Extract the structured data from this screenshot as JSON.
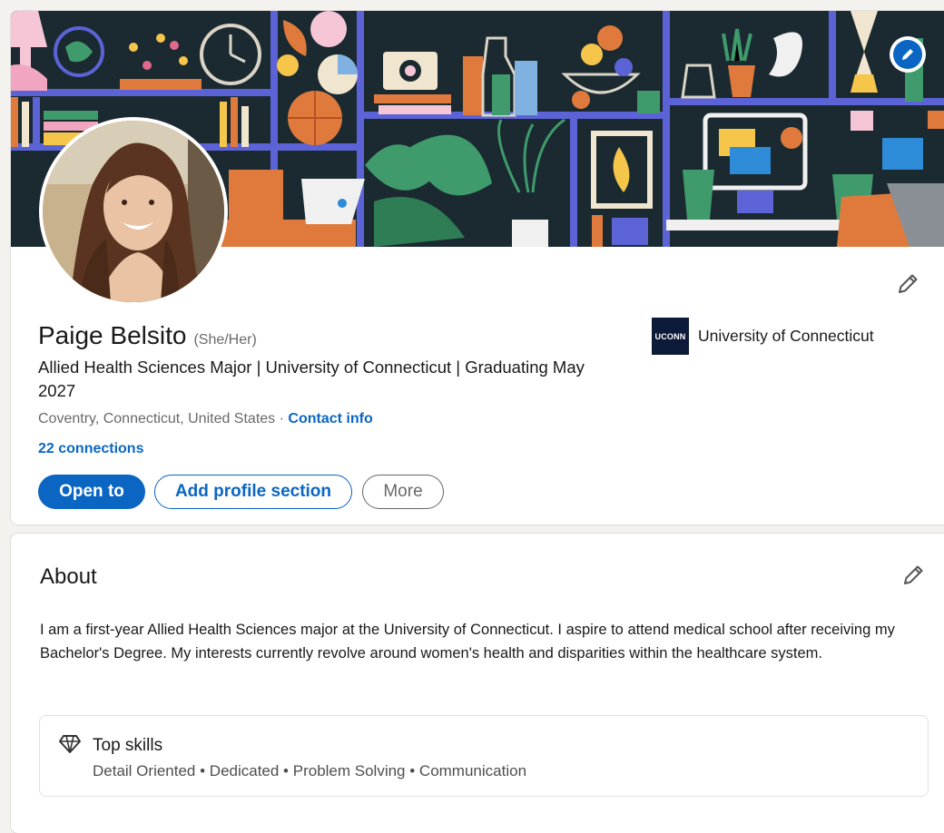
{
  "profile": {
    "name": "Paige Belsito",
    "pronouns": "(She/Her)",
    "headline": "Allied Health Sciences Major | University of Connecticut | Graduating May 2027",
    "location": "Coventry, Connecticut, United States",
    "location_separator": " · ",
    "contact_label": "Contact info",
    "connections": "22 connections",
    "school": {
      "logo_text": "UCONN",
      "name": "University of Connecticut"
    },
    "buttons": {
      "open_to": "Open to",
      "add_section": "Add profile section",
      "more": "More"
    }
  },
  "about": {
    "title": "About",
    "text": "I am a first-year Allied Health Sciences major at the University of Connecticut. I aspire to attend medical school after receiving my Bachelor's Degree. My interests currently revolve around women's health and disparities within the healthcare system.",
    "top_skills": {
      "title": "Top skills",
      "skills": "Detail Oriented • Dedicated • Problem Solving • Communication"
    }
  },
  "colors": {
    "primary": "#0a66c2",
    "background": "#f3f2ef",
    "banner_dark": "#1b2a31",
    "banner_blue": "#5b63d6"
  },
  "icons": {
    "edit": "pencil-icon",
    "skills": "diamond-icon"
  }
}
